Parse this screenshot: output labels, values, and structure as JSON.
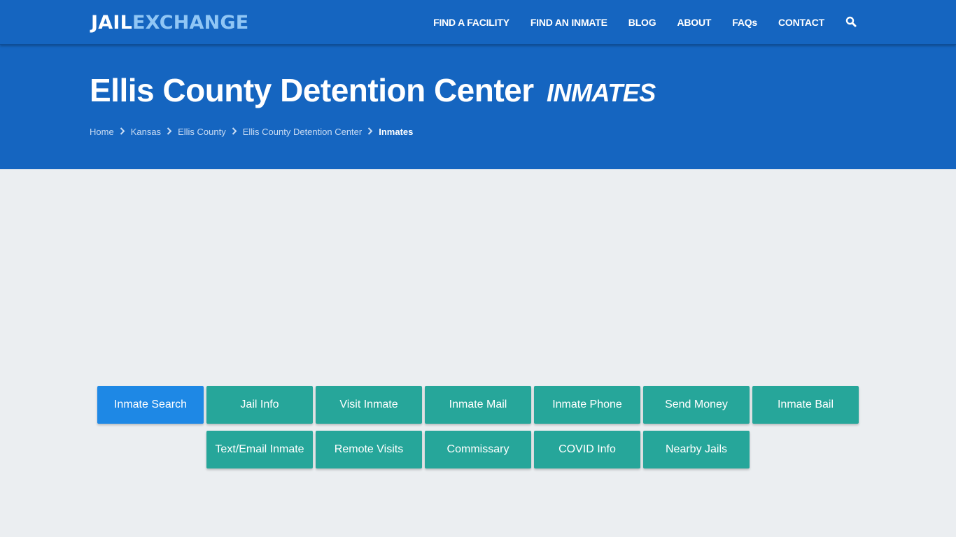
{
  "header": {
    "logo_part1": "JAIL",
    "logo_part2": "EXCHANGE",
    "nav": [
      {
        "label": "FIND A FACILITY"
      },
      {
        "label": "FIND AN INMATE"
      },
      {
        "label": "BLOG"
      },
      {
        "label": "ABOUT"
      },
      {
        "label": "FAQs"
      },
      {
        "label": "CONTACT"
      }
    ],
    "search_icon": "search-icon"
  },
  "hero": {
    "title": "Ellis County Detention Center",
    "subtitle": "INMATES",
    "breadcrumb": [
      {
        "label": "Home"
      },
      {
        "label": "Kansas"
      },
      {
        "label": "Ellis County"
      },
      {
        "label": "Ellis County Detention Center"
      },
      {
        "label": "Inmates"
      }
    ]
  },
  "buttons": {
    "row1": [
      {
        "label": "Inmate Search",
        "active": true
      },
      {
        "label": "Jail Info"
      },
      {
        "label": "Visit Inmate"
      },
      {
        "label": "Inmate Mail"
      },
      {
        "label": "Inmate Phone"
      },
      {
        "label": "Send Money"
      },
      {
        "label": "Inmate Bail"
      }
    ],
    "row2": [
      {
        "label": "Text/Email Inmate"
      },
      {
        "label": "Remote Visits"
      },
      {
        "label": "Commissary"
      },
      {
        "label": "COVID Info"
      },
      {
        "label": "Nearby Jails"
      }
    ]
  },
  "colors": {
    "brand_blue": "#1565c0",
    "logo_accent": "#90c6f5",
    "button_teal": "#26a69a",
    "button_active": "#1e88e5",
    "page_bg": "#ebeef1"
  }
}
